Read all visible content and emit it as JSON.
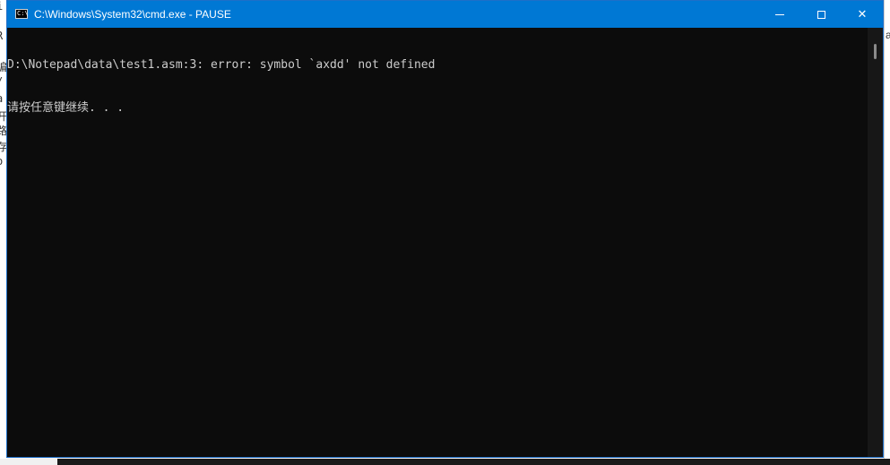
{
  "window": {
    "title": "C:\\Windows\\System32\\cmd.exe - PAUSE",
    "icon_text": "C:\\",
    "icon": "cmd-icon",
    "controls": {
      "minimize_icon": "minimize-icon",
      "maximize_icon": "maximize-icon",
      "close_glyph": "✕"
    }
  },
  "console": {
    "lines": [
      "D:\\Notepad\\data\\test1.asm:3: error: symbol `axdd' not defined",
      "请按任意键继续. . ."
    ]
  },
  "background": {
    "left_fragments": [
      "i",
      "R",
      "编",
      "/",
      "a",
      "开",
      "路",
      "存",
      "o"
    ],
    "right_fragment": "a"
  },
  "colors": {
    "titlebar": "#0078d4",
    "console_bg": "#0c0c0c",
    "console_text": "#cccccc"
  }
}
